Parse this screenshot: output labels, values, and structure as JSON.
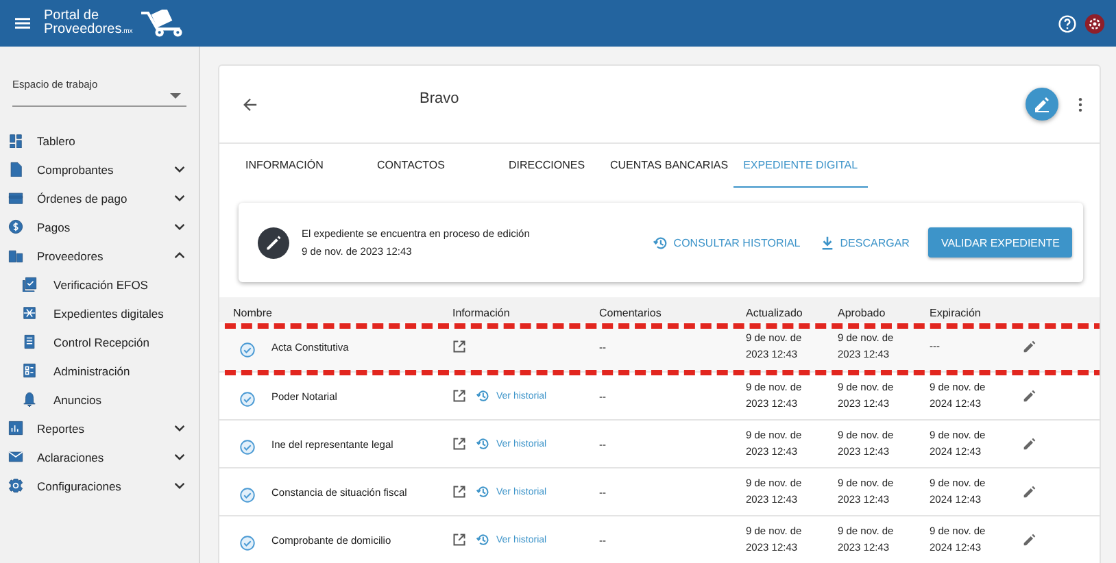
{
  "app_bar": {
    "logo_line_1": "Portal de",
    "logo_line_2": "Proveedores",
    "logo_suffix": ".mx"
  },
  "sidebar": {
    "workspace": {
      "label": "Espacio de trabajo"
    },
    "items": [
      {
        "label": "Tablero",
        "kind": "link"
      },
      {
        "label": "Comprobantes",
        "kind": "group",
        "expanded": false
      },
      {
        "label": "Órdenes de pago",
        "kind": "group",
        "expanded": false
      },
      {
        "label": "Pagos",
        "kind": "group",
        "expanded": false
      },
      {
        "label": "Proveedores",
        "kind": "group",
        "expanded": true,
        "children": [
          {
            "label": "Verificación EFOS"
          },
          {
            "label": "Expedientes digitales"
          },
          {
            "label": "Control Recepción"
          },
          {
            "label": "Administración"
          },
          {
            "label": "Anuncios"
          }
        ]
      },
      {
        "label": "Reportes",
        "kind": "group",
        "expanded": false
      },
      {
        "label": "Aclaraciones",
        "kind": "group",
        "expanded": false
      },
      {
        "label": "Configuraciones",
        "kind": "group",
        "expanded": false
      }
    ]
  },
  "card": {
    "title": "Bravo",
    "tabs": [
      {
        "label": "INFORMACIÓN",
        "selected": false
      },
      {
        "label": "CONTACTOS",
        "selected": false
      },
      {
        "label": "DIRECCIONES",
        "selected": false
      },
      {
        "label": "CUENTAS BANCARIAS",
        "selected": false
      },
      {
        "label": "EXPEDIENTE DIGITAL",
        "selected": true
      }
    ],
    "status": {
      "message": "El expediente se encuentra en proceso de edición",
      "date": "9 de nov. de 2023 12:43",
      "history_link": "CONSULTAR HISTORIAL",
      "download_link": "DESCARGAR",
      "validate_button": "VALIDAR EXPEDIENTE"
    },
    "table": {
      "columns": [
        "Nombre",
        "Información",
        "Comentarios",
        "Actualizado",
        "Aprobado",
        "Expiración"
      ],
      "rows": [
        {
          "name": "Acta Constitutiva",
          "history_link": null,
          "comments": "--",
          "updated": "9 de nov. de 2023 12:43",
          "approved": "9 de nov. de 2023 12:43",
          "expiration": "---",
          "highlighted": true
        },
        {
          "name": "Poder Notarial",
          "history_link": "Ver historial",
          "comments": "--",
          "updated": "9 de nov. de 2023 12:43",
          "approved": "9 de nov. de 2023 12:43",
          "expiration": "9 de nov. de 2024 12:43",
          "highlighted": false
        },
        {
          "name": "Ine del representante legal",
          "history_link": "Ver historial",
          "comments": "--",
          "updated": "9 de nov. de 2023 12:43",
          "approved": "9 de nov. de 2023 12:43",
          "expiration": "9 de nov. de 2024 12:43",
          "highlighted": false
        },
        {
          "name": "Constancia de situación fiscal",
          "history_link": "Ver historial",
          "comments": "--",
          "updated": "9 de nov. de 2023 12:43",
          "approved": "9 de nov. de 2023 12:43",
          "expiration": "9 de nov. de 2024 12:43",
          "highlighted": false
        },
        {
          "name": "Comprobante de domicilio",
          "history_link": "Ver historial",
          "comments": "--",
          "updated": "9 de nov. de 2023 12:43",
          "approved": "9 de nov. de 2023 12:43",
          "expiration": "9 de nov. de 2024 12:43",
          "highlighted": false
        }
      ]
    }
  }
}
